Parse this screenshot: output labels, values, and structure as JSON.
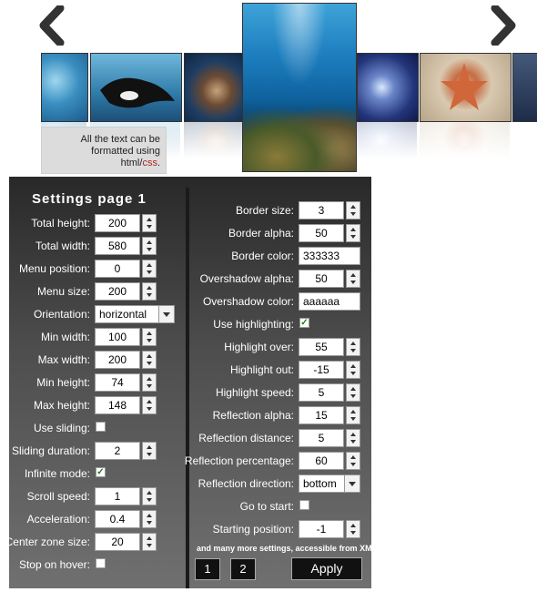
{
  "carousel": {
    "prev_icon": "chevron-left-icon",
    "next_icon": "chevron-right-icon",
    "arrow_color": "#333333",
    "caption_text_1": "All the text can be",
    "caption_text_2": "formatted using",
    "caption_text_3": "html/",
    "caption_css": "css",
    "caption_dot": "."
  },
  "settings": {
    "title": "Settings page 1",
    "left": [
      {
        "label": "Total height:",
        "value": "200",
        "type": "number"
      },
      {
        "label": "Total width:",
        "value": "580",
        "type": "number"
      },
      {
        "label": "Menu position:",
        "value": "0",
        "type": "number"
      },
      {
        "label": "Menu size:",
        "value": "200",
        "type": "number"
      },
      {
        "label": "Orientation:",
        "value": "horizontal",
        "type": "select"
      },
      {
        "label": "Min width:",
        "value": "100",
        "type": "number"
      },
      {
        "label": "Max width:",
        "value": "200",
        "type": "number"
      },
      {
        "label": "Min height:",
        "value": "74",
        "type": "number"
      },
      {
        "label": "Max height:",
        "value": "148",
        "type": "number"
      },
      {
        "label": "Use sliding:",
        "value": "",
        "type": "checkbox"
      },
      {
        "label": "Sliding duration:",
        "value": "2",
        "type": "number"
      },
      {
        "label": "Infinite mode:",
        "value": "✓",
        "type": "checkbox"
      },
      {
        "label": "Scroll speed:",
        "value": "1",
        "type": "number"
      },
      {
        "label": "Acceleration:",
        "value": "0.4",
        "type": "number"
      },
      {
        "label": "Center zone size:",
        "value": "20",
        "type": "number"
      },
      {
        "label": "Stop on hover:",
        "value": "",
        "type": "checkbox"
      }
    ],
    "right": [
      {
        "label": "Border size:",
        "value": "3",
        "type": "number"
      },
      {
        "label": "Border alpha:",
        "value": "50",
        "type": "number"
      },
      {
        "label": "Border color:",
        "value": "333333",
        "type": "text"
      },
      {
        "label": "Overshadow alpha:",
        "value": "50",
        "type": "number"
      },
      {
        "label": "Overshadow color:",
        "value": "aaaaaa",
        "type": "text"
      },
      {
        "label": "Use highlighting:",
        "value": "✓",
        "type": "checkbox"
      },
      {
        "label": "Highlight over:",
        "value": "55",
        "type": "number"
      },
      {
        "label": "Highlight out:",
        "value": "-15",
        "type": "number"
      },
      {
        "label": "Highlight speed:",
        "value": "5",
        "type": "number"
      },
      {
        "label": "Reflection alpha:",
        "value": "15",
        "type": "number"
      },
      {
        "label": "Reflection distance:",
        "value": "5",
        "type": "number"
      },
      {
        "label": "Reflection percentage:",
        "value": "60",
        "type": "number"
      },
      {
        "label": "Reflection direction:",
        "value": "bottom",
        "type": "select"
      },
      {
        "label": "Go to start:",
        "value": "",
        "type": "checkbox"
      },
      {
        "label": "Starting position:",
        "value": "-1",
        "type": "number"
      }
    ],
    "more_text": "and many more settings, accessible from XML",
    "page_buttons": [
      "1",
      "2"
    ],
    "apply_label": "Apply"
  }
}
